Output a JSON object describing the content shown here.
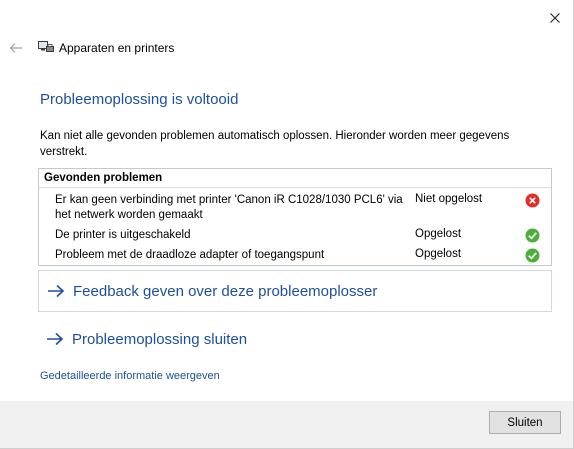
{
  "window": {
    "title": "Apparaten en printers"
  },
  "heading": "Probleemoplossing is voltooid",
  "description": "Kan niet alle gevonden problemen automatisch oplossen. Hieronder worden meer gegevens verstrekt.",
  "problems": {
    "header": "Gevonden problemen",
    "rows": [
      {
        "description": "Er kan geen verbinding met printer 'Canon iR C1028/1030 PCL6' via het netwerk worden gemaakt",
        "status": "Niet opgelost",
        "icon": "error-icon"
      },
      {
        "description": "De printer is uitgeschakeld",
        "status": "Opgelost",
        "icon": "check-icon"
      },
      {
        "description": "Probleem met de draadloze adapter of toegangspunt",
        "status": "Opgelost",
        "icon": "check-icon"
      }
    ]
  },
  "links": {
    "feedback": "Feedback geven over deze probleemoplosser",
    "close_troubleshooter": "Probleemoplossing sluiten",
    "details": "Gedetailleerde informatie weergeven"
  },
  "footer": {
    "close_label": "Sluiten"
  },
  "colors": {
    "accent": "#1e4f9e",
    "error": "#e0302c",
    "success": "#4caf3a"
  }
}
